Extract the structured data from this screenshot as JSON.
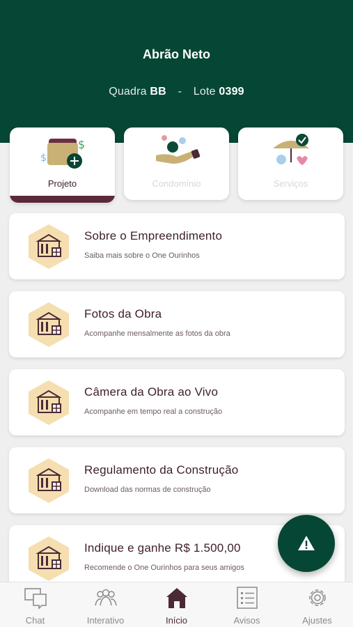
{
  "header": {
    "user_name": "Abrão Neto",
    "quadra_label": "Quadra",
    "quadra_value": "BB",
    "separator": "-",
    "lote_label": "Lote",
    "lote_value": "0399"
  },
  "categories": [
    {
      "label": "Projeto",
      "icon": "wallet-money-icon",
      "active": true
    },
    {
      "label": "Condomínio",
      "icon": "hand-coins-icon",
      "active": false
    },
    {
      "label": "Serviços",
      "icon": "umbrella-shield-heart-icon",
      "active": false
    }
  ],
  "cards": [
    {
      "title": "Sobre o Empreendimento",
      "subtitle": "Saiba mais sobre o One Ourinhos",
      "icon": "building-hexagon-icon"
    },
    {
      "title": "Fotos da Obra",
      "subtitle": "Acompanhe mensalmente as fotos da obra",
      "icon": "building-hexagon-icon"
    },
    {
      "title": "Câmera da Obra ao Vivo",
      "subtitle": "Acompanhe em tempo real a construção",
      "icon": "building-hexagon-icon"
    },
    {
      "title": "Regulamento da Construção",
      "subtitle": "Download das normas de construção",
      "icon": "building-hexagon-icon"
    },
    {
      "title": "Indique e ganhe R$ 1.500,00",
      "subtitle": "Recomende o One Ourinhos para seus amigos",
      "icon": "building-hexagon-icon"
    }
  ],
  "fab": {
    "icon": "warning-icon"
  },
  "tabs": [
    {
      "label": "Chat",
      "icon": "chat-icon"
    },
    {
      "label": "Interativo",
      "icon": "people-icon"
    },
    {
      "label": "Início",
      "icon": "home-icon",
      "active": true
    },
    {
      "label": "Avisos",
      "icon": "list-icon"
    },
    {
      "label": "Ajustes",
      "icon": "gear-icon"
    }
  ],
  "colors": {
    "brand_green": "#064634",
    "accent_wine": "#5a2a3a",
    "hex_fill": "#f5deb0",
    "background": "#efefef"
  }
}
